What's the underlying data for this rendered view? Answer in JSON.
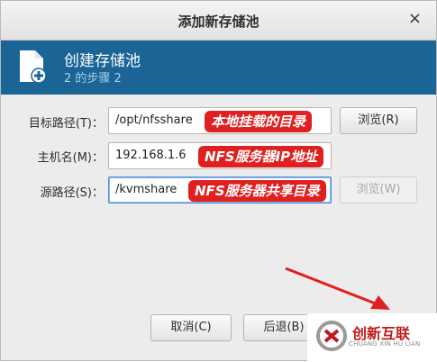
{
  "window": {
    "title": "添加新存储池",
    "close_glyph": "×"
  },
  "header": {
    "title": "创建存储池",
    "step": "2 的步骤 2",
    "icon": "new-file-icon"
  },
  "form": {
    "target_path": {
      "label": "目标路径(T)：",
      "value": "/opt/nfsshare",
      "browse_label": "浏览(R)"
    },
    "host_name": {
      "label": "主机名(M)：",
      "value": "192.168.1.6"
    },
    "source_path": {
      "label": "源路径(S)：",
      "value": "/kvmshare",
      "browse_label": "浏览(W)"
    }
  },
  "annotations": {
    "target_path_note": "本地挂载的目录",
    "host_note": "NFS服务器IP地址",
    "source_note": "NFS服务器共享目录"
  },
  "buttons": {
    "cancel_label": "取消(C)",
    "back_label": "后退(B)"
  },
  "watermark": {
    "brand": "创新互联",
    "sub": "CHUANG XIN HU LIAN"
  },
  "colors": {
    "header_bg": "#1a6496",
    "annotation_bg": "#e02020",
    "arrow": "#e02020"
  }
}
